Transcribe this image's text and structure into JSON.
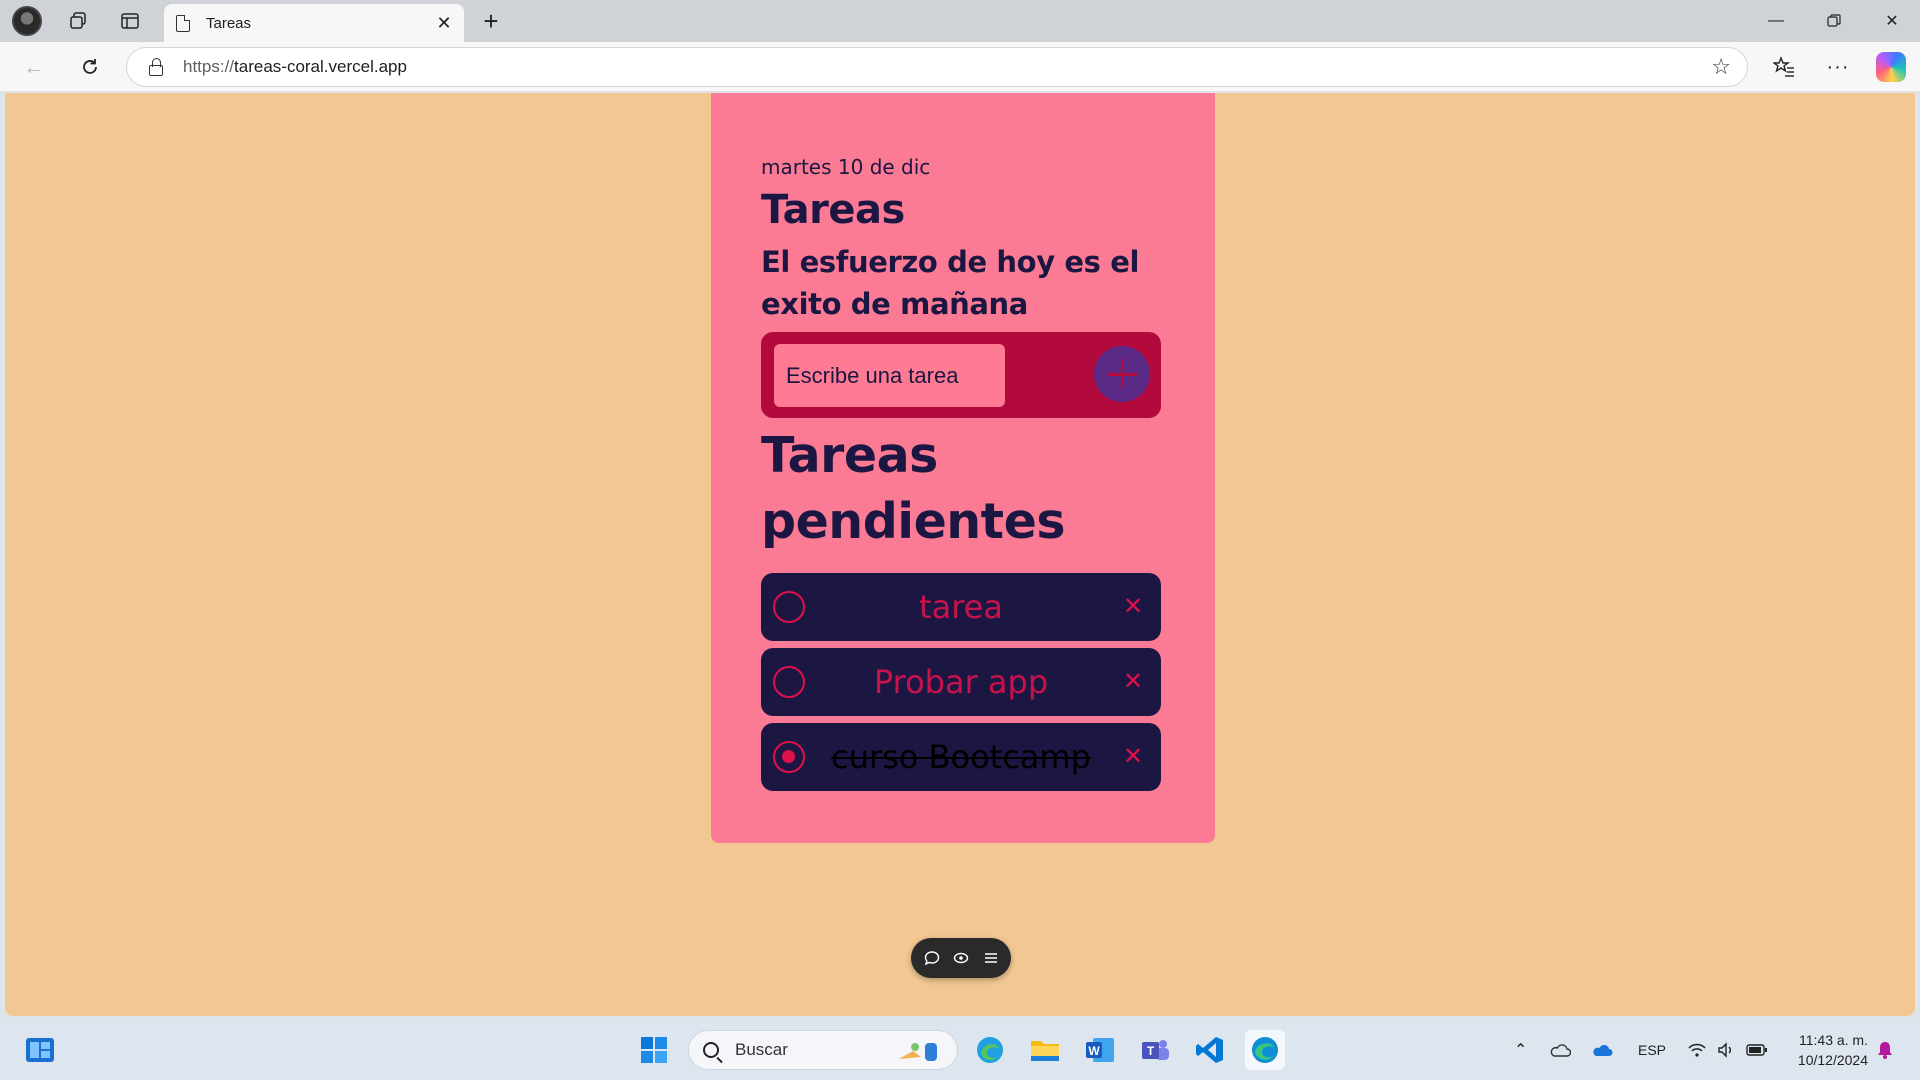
{
  "browser": {
    "tab_title": "Tareas",
    "url_protocol": "https://",
    "url_host": "tareas-coral.vercel.app"
  },
  "app": {
    "date": "martes 10 de dic",
    "title": "Tareas",
    "motto": "El esfuerzo de hoy es el exito de mañana",
    "input_placeholder": "Escribe una tarea",
    "pending_title": "Tareas pendientes",
    "tasks": [
      {
        "text": "tarea",
        "completed": false
      },
      {
        "text": "Probar app",
        "completed": false
      },
      {
        "text": "curso Bootcamp",
        "completed": true
      }
    ],
    "colors": {
      "page_bg": "#f2c791",
      "card_bg": "#fa7b93",
      "form_bg": "#b20a3d",
      "task_bg": "#1c1742",
      "accent": "#e0104a",
      "add_button": "#5b2a86"
    }
  },
  "taskbar": {
    "search_placeholder": "Buscar",
    "language": "ESP",
    "time": "11:43 a. m.",
    "date": "10/12/2024"
  }
}
